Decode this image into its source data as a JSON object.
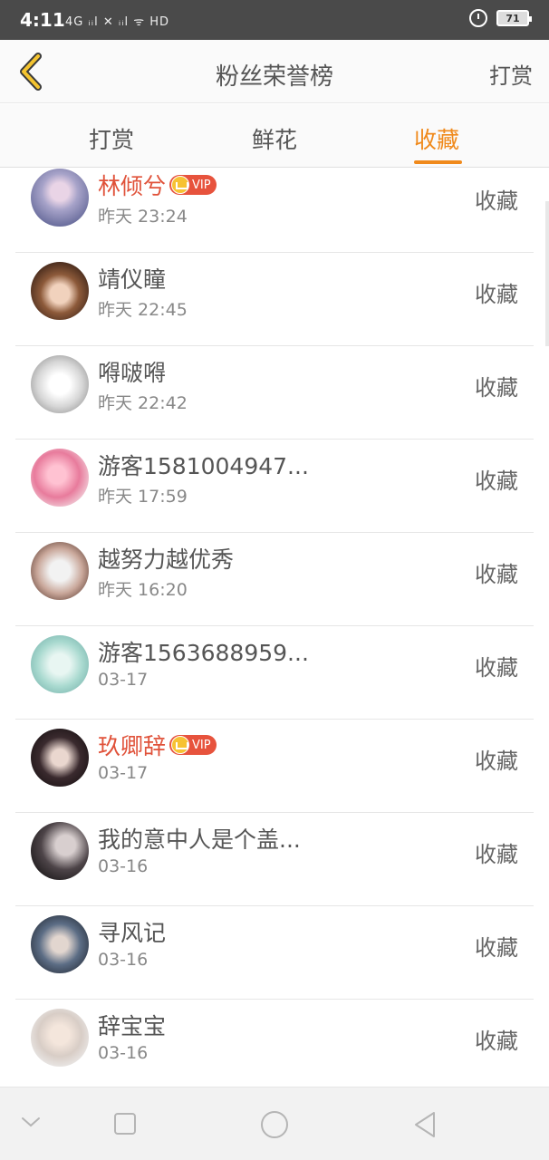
{
  "status_bar": {
    "time": "4:11",
    "indicators": "4G ᵢᵢl ✕ ᵢᵢl  ᯤ  HD",
    "battery": "71"
  },
  "header": {
    "title": "粉丝荣誉榜",
    "right_link": "打赏",
    "back_icon": "chevron-left-icon",
    "accent_color": "#f08a1c"
  },
  "tabs": [
    {
      "label": "打赏",
      "active": false
    },
    {
      "label": "鲜花",
      "active": false
    },
    {
      "label": "收藏",
      "active": true
    }
  ],
  "vip_label": "VIP",
  "fans": [
    {
      "name": "林倾兮",
      "vip": true,
      "time": "昨天 23:24",
      "action": "收藏"
    },
    {
      "name": "靖仪瞳",
      "vip": false,
      "time": "昨天 22:45",
      "action": "收藏"
    },
    {
      "name": "嘚啵嘚",
      "vip": false,
      "time": "昨天 22:42",
      "action": "收藏"
    },
    {
      "name": "游客1581004947...",
      "vip": false,
      "time": "昨天 17:59",
      "action": "收藏"
    },
    {
      "name": "越努力越优秀",
      "vip": false,
      "time": "昨天 16:20",
      "action": "收藏"
    },
    {
      "name": "游客1563688959...",
      "vip": false,
      "time": "03-17",
      "action": "收藏"
    },
    {
      "name": "玖卿辞",
      "vip": true,
      "time": "03-17",
      "action": "收藏"
    },
    {
      "name": "我的意中人是个盖...",
      "vip": false,
      "time": "03-16",
      "action": "收藏"
    },
    {
      "name": "寻风记",
      "vip": false,
      "time": "03-16",
      "action": "收藏"
    },
    {
      "name": "辞宝宝",
      "vip": false,
      "time": "03-16",
      "action": "收藏"
    }
  ],
  "nav_bar": {
    "icons": [
      "chevron-down-icon",
      "recents-square-icon",
      "home-circle-icon",
      "back-triangle-icon"
    ]
  }
}
